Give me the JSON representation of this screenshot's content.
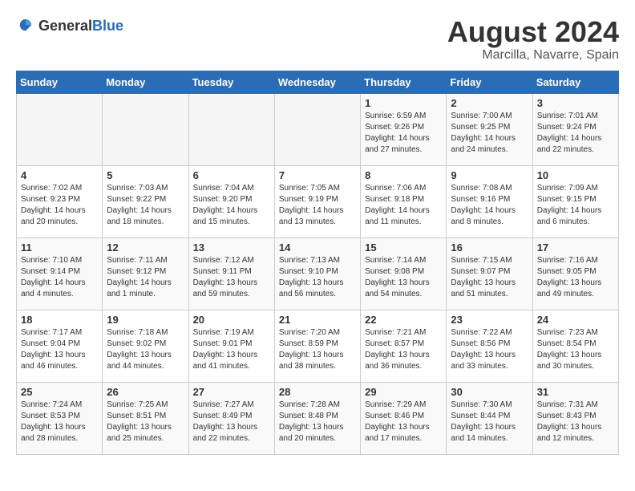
{
  "header": {
    "logo_general": "General",
    "logo_blue": "Blue",
    "title": "August 2024",
    "subtitle": "Marcilla, Navarre, Spain"
  },
  "days_of_week": [
    "Sunday",
    "Monday",
    "Tuesday",
    "Wednesday",
    "Thursday",
    "Friday",
    "Saturday"
  ],
  "weeks": [
    [
      {
        "day": "",
        "info": ""
      },
      {
        "day": "",
        "info": ""
      },
      {
        "day": "",
        "info": ""
      },
      {
        "day": "",
        "info": ""
      },
      {
        "day": "1",
        "info": "Sunrise: 6:59 AM\nSunset: 9:26 PM\nDaylight: 14 hours\nand 27 minutes."
      },
      {
        "day": "2",
        "info": "Sunrise: 7:00 AM\nSunset: 9:25 PM\nDaylight: 14 hours\nand 24 minutes."
      },
      {
        "day": "3",
        "info": "Sunrise: 7:01 AM\nSunset: 9:24 PM\nDaylight: 14 hours\nand 22 minutes."
      }
    ],
    [
      {
        "day": "4",
        "info": "Sunrise: 7:02 AM\nSunset: 9:23 PM\nDaylight: 14 hours\nand 20 minutes."
      },
      {
        "day": "5",
        "info": "Sunrise: 7:03 AM\nSunset: 9:22 PM\nDaylight: 14 hours\nand 18 minutes."
      },
      {
        "day": "6",
        "info": "Sunrise: 7:04 AM\nSunset: 9:20 PM\nDaylight: 14 hours\nand 15 minutes."
      },
      {
        "day": "7",
        "info": "Sunrise: 7:05 AM\nSunset: 9:19 PM\nDaylight: 14 hours\nand 13 minutes."
      },
      {
        "day": "8",
        "info": "Sunrise: 7:06 AM\nSunset: 9:18 PM\nDaylight: 14 hours\nand 11 minutes."
      },
      {
        "day": "9",
        "info": "Sunrise: 7:08 AM\nSunset: 9:16 PM\nDaylight: 14 hours\nand 8 minutes."
      },
      {
        "day": "10",
        "info": "Sunrise: 7:09 AM\nSunset: 9:15 PM\nDaylight: 14 hours\nand 6 minutes."
      }
    ],
    [
      {
        "day": "11",
        "info": "Sunrise: 7:10 AM\nSunset: 9:14 PM\nDaylight: 14 hours\nand 4 minutes."
      },
      {
        "day": "12",
        "info": "Sunrise: 7:11 AM\nSunset: 9:12 PM\nDaylight: 14 hours\nand 1 minute."
      },
      {
        "day": "13",
        "info": "Sunrise: 7:12 AM\nSunset: 9:11 PM\nDaylight: 13 hours\nand 59 minutes."
      },
      {
        "day": "14",
        "info": "Sunrise: 7:13 AM\nSunset: 9:10 PM\nDaylight: 13 hours\nand 56 minutes."
      },
      {
        "day": "15",
        "info": "Sunrise: 7:14 AM\nSunset: 9:08 PM\nDaylight: 13 hours\nand 54 minutes."
      },
      {
        "day": "16",
        "info": "Sunrise: 7:15 AM\nSunset: 9:07 PM\nDaylight: 13 hours\nand 51 minutes."
      },
      {
        "day": "17",
        "info": "Sunrise: 7:16 AM\nSunset: 9:05 PM\nDaylight: 13 hours\nand 49 minutes."
      }
    ],
    [
      {
        "day": "18",
        "info": "Sunrise: 7:17 AM\nSunset: 9:04 PM\nDaylight: 13 hours\nand 46 minutes."
      },
      {
        "day": "19",
        "info": "Sunrise: 7:18 AM\nSunset: 9:02 PM\nDaylight: 13 hours\nand 44 minutes."
      },
      {
        "day": "20",
        "info": "Sunrise: 7:19 AM\nSunset: 9:01 PM\nDaylight: 13 hours\nand 41 minutes."
      },
      {
        "day": "21",
        "info": "Sunrise: 7:20 AM\nSunset: 8:59 PM\nDaylight: 13 hours\nand 38 minutes."
      },
      {
        "day": "22",
        "info": "Sunrise: 7:21 AM\nSunset: 8:57 PM\nDaylight: 13 hours\nand 36 minutes."
      },
      {
        "day": "23",
        "info": "Sunrise: 7:22 AM\nSunset: 8:56 PM\nDaylight: 13 hours\nand 33 minutes."
      },
      {
        "day": "24",
        "info": "Sunrise: 7:23 AM\nSunset: 8:54 PM\nDaylight: 13 hours\nand 30 minutes."
      }
    ],
    [
      {
        "day": "25",
        "info": "Sunrise: 7:24 AM\nSunset: 8:53 PM\nDaylight: 13 hours\nand 28 minutes."
      },
      {
        "day": "26",
        "info": "Sunrise: 7:25 AM\nSunset: 8:51 PM\nDaylight: 13 hours\nand 25 minutes."
      },
      {
        "day": "27",
        "info": "Sunrise: 7:27 AM\nSunset: 8:49 PM\nDaylight: 13 hours\nand 22 minutes."
      },
      {
        "day": "28",
        "info": "Sunrise: 7:28 AM\nSunset: 8:48 PM\nDaylight: 13 hours\nand 20 minutes."
      },
      {
        "day": "29",
        "info": "Sunrise: 7:29 AM\nSunset: 8:46 PM\nDaylight: 13 hours\nand 17 minutes."
      },
      {
        "day": "30",
        "info": "Sunrise: 7:30 AM\nSunset: 8:44 PM\nDaylight: 13 hours\nand 14 minutes."
      },
      {
        "day": "31",
        "info": "Sunrise: 7:31 AM\nSunset: 8:43 PM\nDaylight: 13 hours\nand 12 minutes."
      }
    ]
  ]
}
